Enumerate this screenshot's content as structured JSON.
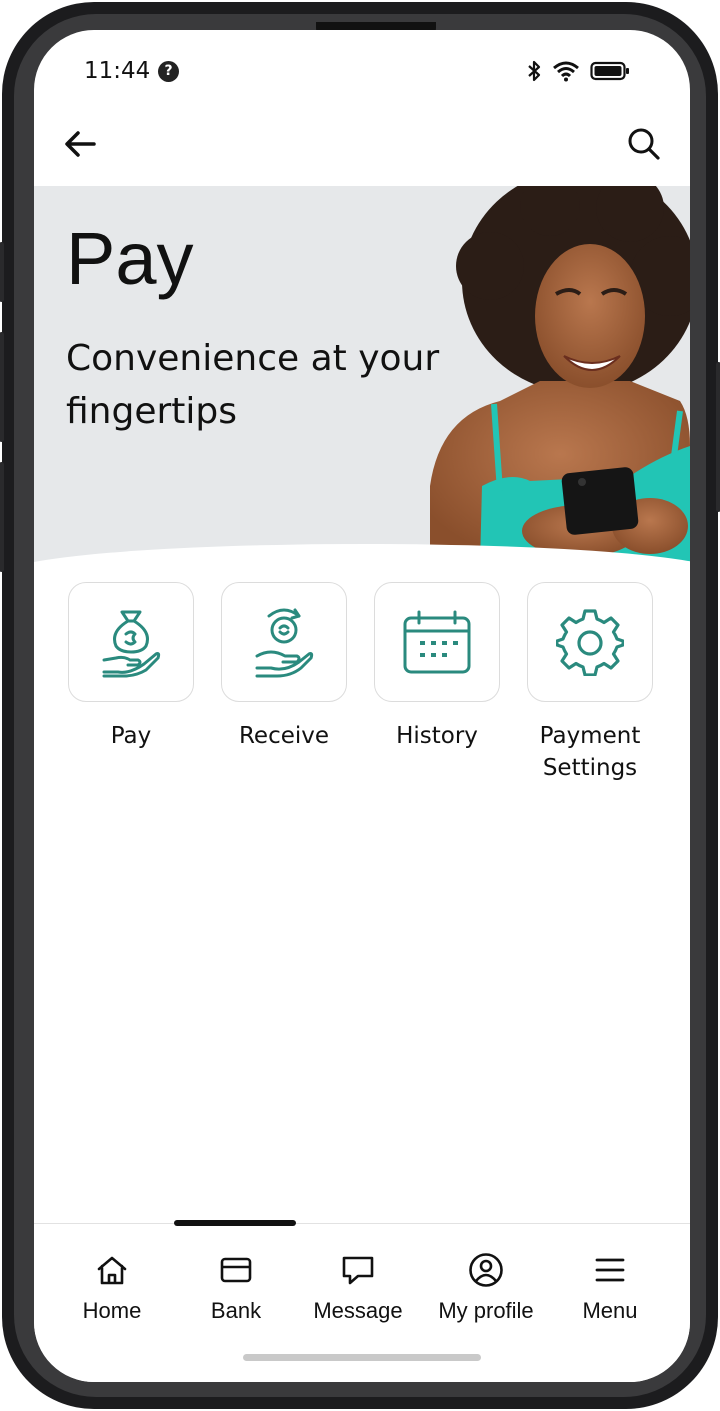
{
  "status_bar": {
    "time": "11:44"
  },
  "hero": {
    "title": "Pay",
    "subtitle": "Convenience at your fingertips"
  },
  "actions": [
    {
      "label": "Pay",
      "icon": "hand-money-bag-icon"
    },
    {
      "label": "Receive",
      "icon": "hand-receive-money-icon"
    },
    {
      "label": "History",
      "icon": "calendar-icon"
    },
    {
      "label": "Payment Settings",
      "icon": "gear-icon"
    }
  ],
  "tabs": [
    {
      "label": "Home",
      "icon": "home-icon"
    },
    {
      "label": "Bank",
      "icon": "card-icon"
    },
    {
      "label": "Message",
      "icon": "chat-icon"
    },
    {
      "label": "My profile",
      "icon": "profile-icon"
    },
    {
      "label": "Menu",
      "icon": "hamburger-menu-icon"
    }
  ],
  "colors": {
    "accent": "#2a8a7e",
    "hero_bg": "#e6e8ea",
    "top_green": "#22c5b5"
  }
}
